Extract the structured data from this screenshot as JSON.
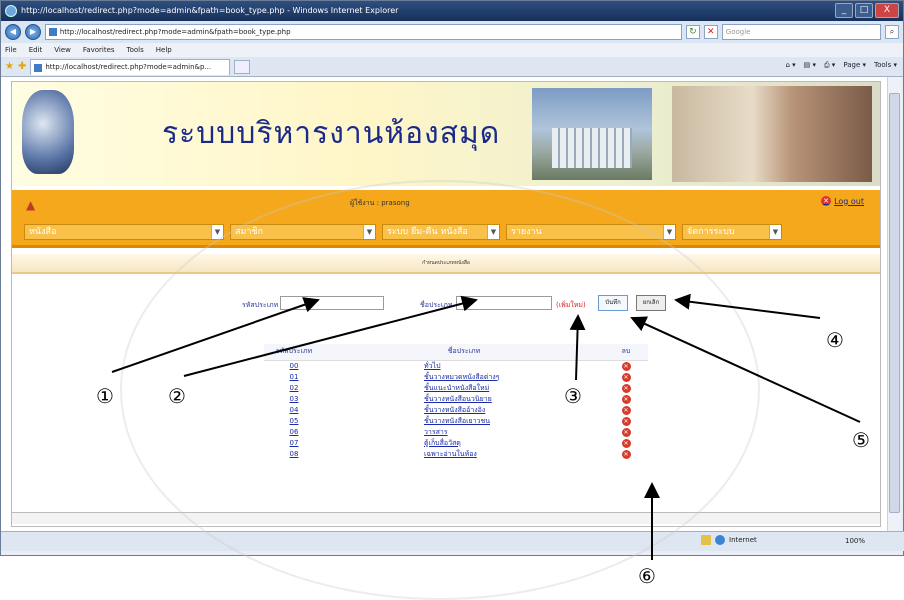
{
  "window": {
    "title": "http://localhost/redirect.php?mode=admin&fpath=book_type.php - Windows Internet Explorer",
    "url": "http://localhost/redirect.php?mode=admin&fpath=book_type.php",
    "search_placeholder": "Google",
    "menu": [
      "File",
      "Edit",
      "View",
      "Favorites",
      "Tools",
      "Help"
    ],
    "tab_label": "http://localhost/redirect.php?mode=admin&p...",
    "toolbar": {
      "page_label": "Page ▾",
      "tools_label": "Tools ▾"
    },
    "status": {
      "zone": "Internet",
      "zoom": "100%"
    }
  },
  "banner": {
    "title": "ระบบบริหารงานห้องสมุด"
  },
  "header": {
    "user_text": "ผู้ใช้งาน : prasong",
    "logout": "Log out",
    "menus": [
      "หนังสือ",
      "สมาชิก",
      "ระบบ ยืม-คืน หนังสือ",
      "รายงาน",
      "จัดการระบบ"
    ]
  },
  "page_heading": "กำหนดประเภทหนังสือ",
  "form": {
    "code_label": "รหัสประเภท",
    "name_label": "ชื่อประเภท",
    "add_new_label": "(เพิ่มใหม่)",
    "save_button": "บันทึก",
    "cancel_button": "ยกเลิก"
  },
  "table": {
    "headers": [
      "รหัสประเภท",
      "ชื่อประเภท",
      "ลบ"
    ],
    "rows": [
      {
        "code": "00",
        "name": "ทั่วไป"
      },
      {
        "code": "01",
        "name": "ชั้นวางหมวดหนังสือต่างๆ"
      },
      {
        "code": "02",
        "name": "ชั้นแนะนำหนังสือใหม่"
      },
      {
        "code": "03",
        "name": "ชั้นวางหนังสือนวนิยาย"
      },
      {
        "code": "04",
        "name": "ชั้นวางหนังสืออ้างอิง"
      },
      {
        "code": "05",
        "name": "ชั้นวางหนังสือเยาวชน"
      },
      {
        "code": "06",
        "name": "วารสาร"
      },
      {
        "code": "07",
        "name": "ตู้เก็บสื่อวัสดุ"
      },
      {
        "code": "08",
        "name": "เฉพาะอ่านในห้อง"
      }
    ]
  },
  "callouts": [
    "①",
    "②",
    "③",
    "④",
    "⑤",
    "⑥"
  ]
}
